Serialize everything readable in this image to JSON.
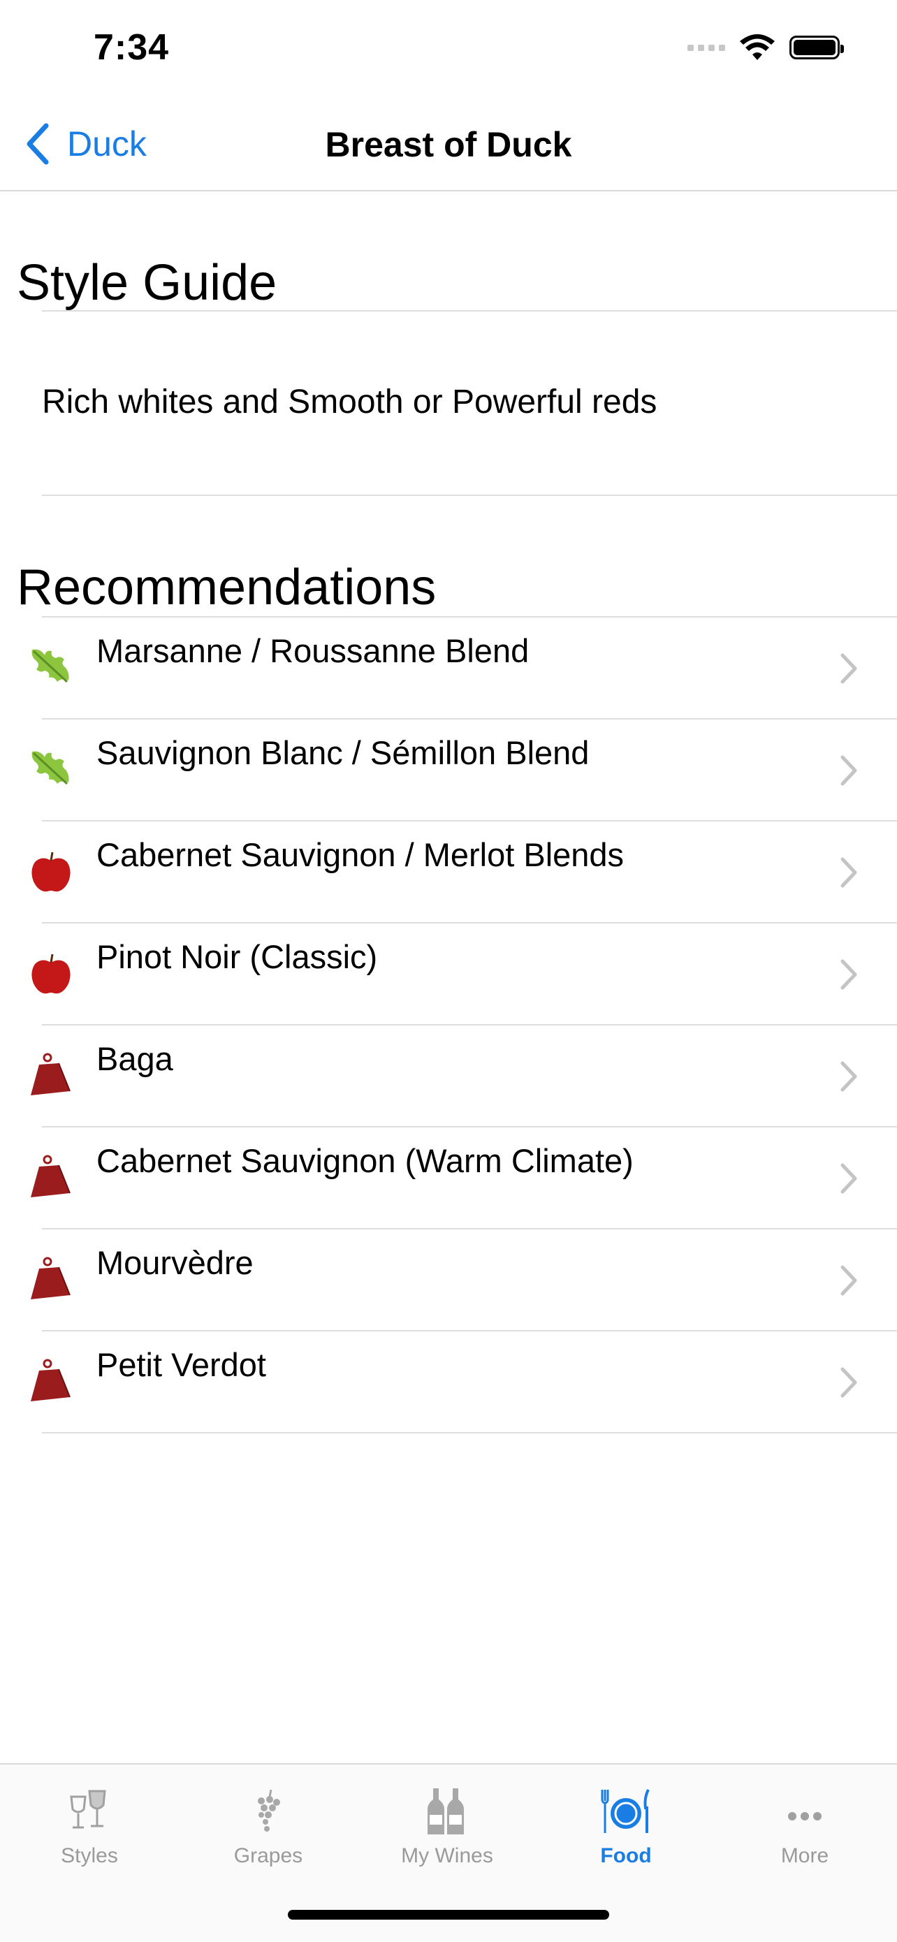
{
  "status_bar": {
    "time": "7:34"
  },
  "nav": {
    "back_label": "Duck",
    "title": "Breast of Duck"
  },
  "style_guide": {
    "heading": "Style Guide",
    "text": "Rich whites and Smooth or Powerful reds"
  },
  "recommendations": {
    "heading": "Recommendations",
    "items": [
      {
        "label": "Marsanne / Roussanne Blend",
        "icon": "green-leaf-icon"
      },
      {
        "label": "Sauvignon Blanc / Sémillon Blend",
        "icon": "green-leaf-icon"
      },
      {
        "label": "Cabernet Sauvignon / Merlot Blends",
        "icon": "red-apple-icon"
      },
      {
        "label": "Pinot Noir (Classic)",
        "icon": "red-apple-icon"
      },
      {
        "label": "Baga",
        "icon": "weight-icon"
      },
      {
        "label": "Cabernet Sauvignon (Warm Climate)",
        "icon": "weight-icon"
      },
      {
        "label": "Mourvèdre",
        "icon": "weight-icon"
      },
      {
        "label": "Petit Verdot",
        "icon": "weight-icon"
      }
    ]
  },
  "tab_bar": {
    "tabs": [
      {
        "label": "Styles",
        "icon": "wine-glasses-icon",
        "active": false
      },
      {
        "label": "Grapes",
        "icon": "grapes-icon",
        "active": false
      },
      {
        "label": "My Wines",
        "icon": "wine-bottles-icon",
        "active": false
      },
      {
        "label": "Food",
        "icon": "plate-cutlery-icon",
        "active": true
      },
      {
        "label": "More",
        "icon": "more-dots-icon",
        "active": false
      }
    ]
  },
  "colors": {
    "accent": "#1a7de3",
    "leaf": "#8cc63f",
    "apple": "#c41717",
    "weight": "#9b1c1c"
  }
}
